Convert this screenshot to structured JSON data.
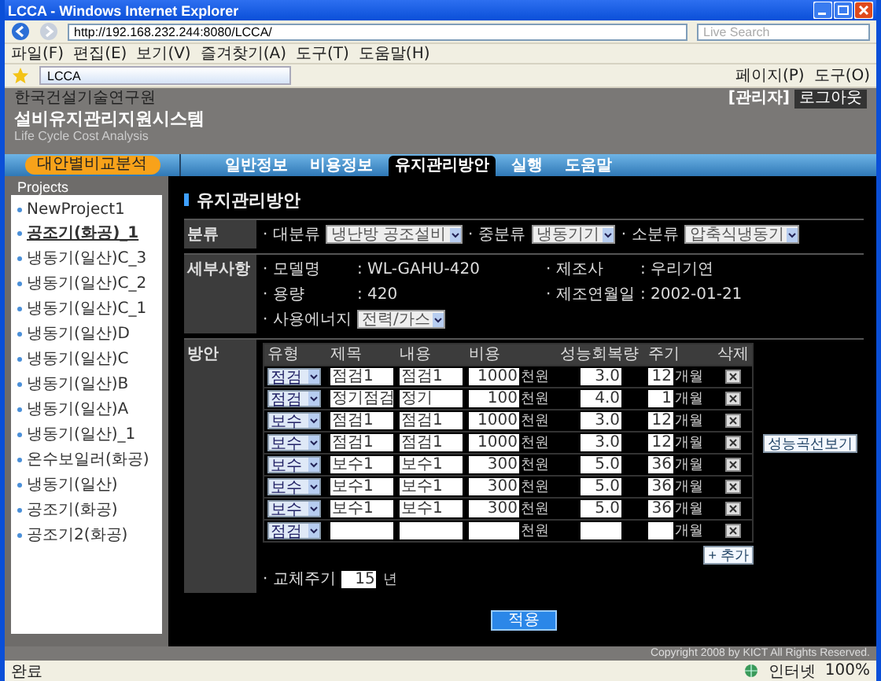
{
  "window": {
    "title": "LCCA - Windows Internet Explorer"
  },
  "browser": {
    "url": "http://192.168.232.244:8080/LCCA/",
    "search_placeholder": "Live Search",
    "menu": [
      "파일(F)",
      "편집(E)",
      "보기(V)",
      "즐겨찾기(A)",
      "도구(T)",
      "도움말(H)"
    ],
    "tab_title": "LCCA",
    "toolbar": [
      "페이지(P)",
      "도구(O)"
    ]
  },
  "header": {
    "org": "한국건설기술연구원",
    "system": "설비유지관리지원시스템",
    "subtitle": "Life Cycle Cost Analysis",
    "user": "[관리자]",
    "logout": "로그아웃"
  },
  "side_button": "대안별비교분석",
  "nav": {
    "tabs": [
      {
        "label": "일반정보",
        "selected": false
      },
      {
        "label": "비용정보",
        "selected": false
      },
      {
        "label": "유지관리방안",
        "selected": true
      },
      {
        "label": "실행",
        "selected": false
      },
      {
        "label": "도움말",
        "selected": false
      }
    ]
  },
  "sidebar": {
    "title": "Projects",
    "items": [
      {
        "label": "NewProject1",
        "selected": false
      },
      {
        "label": "공조기(화공)_1",
        "selected": true
      },
      {
        "label": "냉동기(일산)C_3",
        "selected": false
      },
      {
        "label": "냉동기(일산)C_2",
        "selected": false
      },
      {
        "label": "냉동기(일산)C_1",
        "selected": false
      },
      {
        "label": "냉동기(일산)D",
        "selected": false
      },
      {
        "label": "냉동기(일산)C",
        "selected": false
      },
      {
        "label": "냉동기(일산)B",
        "selected": false
      },
      {
        "label": "냉동기(일산)A",
        "selected": false
      },
      {
        "label": "냉동기(일산)_1",
        "selected": false
      },
      {
        "label": "온수보일러(화공)",
        "selected": false
      },
      {
        "label": "냉동기(일산)",
        "selected": false
      },
      {
        "label": "공조기(화공)",
        "selected": false
      },
      {
        "label": "공조기2(화공)",
        "selected": false
      }
    ]
  },
  "page_title": "유지관리방안",
  "classification": {
    "label": "분류",
    "fields": [
      {
        "label": "· 대분류",
        "value": "냉난방 공조설비"
      },
      {
        "label": "· 중분류",
        "value": "냉동기기"
      },
      {
        "label": "· 소분류",
        "value": "압축식냉동기"
      }
    ]
  },
  "details": {
    "label": "세부사항",
    "fields": [
      {
        "kind": "text",
        "label": "· 모델명",
        "value": ": WL-GAHU-420"
      },
      {
        "kind": "text",
        "label": "· 제조사",
        "value": ": 우리기연"
      },
      {
        "kind": "text",
        "label": "· 용량",
        "value": ": 420"
      },
      {
        "kind": "text",
        "label": "· 제조연월일",
        "value": ": 2002-01-21"
      },
      {
        "kind": "select",
        "label": "· 사용에너지",
        "value": "전력/가스"
      }
    ]
  },
  "plan": {
    "label": "방안",
    "columns": [
      "유형",
      "제목",
      "내용",
      "비용",
      "성능회복량",
      "주기",
      "삭제"
    ],
    "rows": [
      {
        "type": "점검",
        "title": "점검1",
        "content": "점검1",
        "cost": "1000",
        "cost_unit": "천원",
        "recovery": "3.0",
        "cycle": "12",
        "cycle_unit": "개월"
      },
      {
        "type": "점검",
        "title": "정기점검",
        "content": "정기",
        "cost": "100",
        "cost_unit": "천원",
        "recovery": "4.0",
        "cycle": "1",
        "cycle_unit": "개월"
      },
      {
        "type": "보수",
        "title": "점검1",
        "content": "점검1",
        "cost": "1000",
        "cost_unit": "천원",
        "recovery": "3.0",
        "cycle": "12",
        "cycle_unit": "개월"
      },
      {
        "type": "보수",
        "title": "점검1",
        "content": "점검1",
        "cost": "1000",
        "cost_unit": "천원",
        "recovery": "3.0",
        "cycle": "12",
        "cycle_unit": "개월"
      },
      {
        "type": "보수",
        "title": "보수1",
        "content": "보수1",
        "cost": "300",
        "cost_unit": "천원",
        "recovery": "5.0",
        "cycle": "36",
        "cycle_unit": "개월"
      },
      {
        "type": "보수",
        "title": "보수1",
        "content": "보수1",
        "cost": "300",
        "cost_unit": "천원",
        "recovery": "5.0",
        "cycle": "36",
        "cycle_unit": "개월"
      },
      {
        "type": "보수",
        "title": "보수1",
        "content": "보수1",
        "cost": "300",
        "cost_unit": "천원",
        "recovery": "5.0",
        "cycle": "36",
        "cycle_unit": "개월"
      },
      {
        "type": "점검",
        "title": "",
        "content": "",
        "cost": "",
        "cost_unit": "천원",
        "recovery": "",
        "cycle": "",
        "cycle_unit": "개월"
      }
    ],
    "add_button": "+ 추가",
    "curve_button": "성능곡선보기",
    "replacement": {
      "label": "· 교체주기",
      "value": "15",
      "unit": "년"
    }
  },
  "apply_button": "적용",
  "footer": "Copyright 2008 by KICT All Rights Reserved.",
  "status_bar": {
    "text": "완료",
    "zone": "인터넷",
    "zoom": "100%"
  }
}
